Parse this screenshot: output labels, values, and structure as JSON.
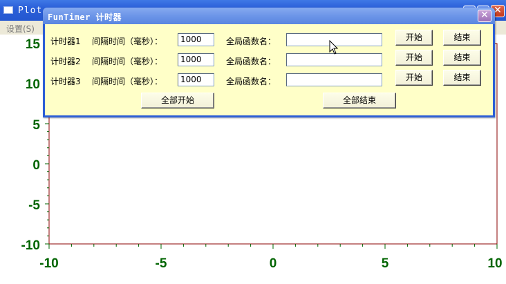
{
  "plot_window": {
    "title": "Plot",
    "menu": [
      "设置(S)"
    ],
    "x_ticks": [
      "-10",
      "-5",
      "0",
      "5",
      "10"
    ],
    "y_ticks": [
      "15",
      "10",
      "5",
      "0",
      "-5",
      "-10"
    ],
    "colors": {
      "tick_label": "#006400",
      "frame": "#8b0000"
    }
  },
  "dialog": {
    "title": "FunTimer 计时器",
    "timers": [
      {
        "name": "计时器1",
        "interval_label": "间隔时间（毫秒）：",
        "interval_value": "1000",
        "func_label": "全局函数名：",
        "func_value": "",
        "start_label": "开始",
        "stop_label": "结束"
      },
      {
        "name": "计时器2",
        "interval_label": "间隔时间（毫秒）：",
        "interval_value": "1000",
        "func_label": "全局函数名：",
        "func_value": "",
        "start_label": "开始",
        "stop_label": "结束"
      },
      {
        "name": "计时器3",
        "interval_label": "间隔时间（毫秒）：",
        "interval_value": "1000",
        "func_label": "全局函数名：",
        "func_value": "",
        "start_label": "开始",
        "stop_label": "结束"
      }
    ],
    "start_all_label": "全部开始",
    "stop_all_label": "全部结束"
  }
}
